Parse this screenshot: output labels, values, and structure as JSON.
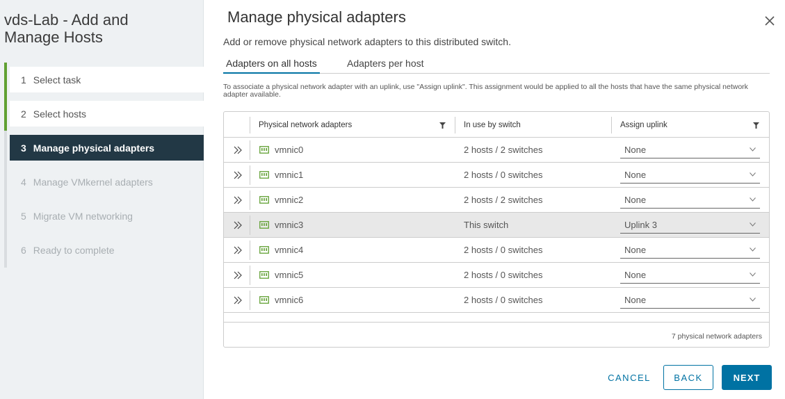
{
  "sidebar": {
    "title": "vds-Lab - Add and Manage Hosts",
    "steps": [
      {
        "num": "1",
        "label": "Select task"
      },
      {
        "num": "2",
        "label": "Select hosts"
      },
      {
        "num": "3",
        "label": "Manage physical adapters"
      },
      {
        "num": "4",
        "label": "Manage VMkernel adapters"
      },
      {
        "num": "5",
        "label": "Migrate VM networking"
      },
      {
        "num": "6",
        "label": "Ready to complete"
      }
    ]
  },
  "main": {
    "title": "Manage physical adapters",
    "subtitle": "Add or remove physical network adapters to this distributed switch.",
    "tabs": [
      {
        "label": "Adapters on all hosts"
      },
      {
        "label": "Adapters per host"
      }
    ],
    "note": "To associate a physical network adapter with an uplink, use \"Assign uplink\". This assignment would be applied to all the hosts that have the same physical network adapter available.",
    "grid": {
      "columns": [
        "Physical network adapters",
        "In use by switch",
        "Assign uplink"
      ],
      "rows": [
        {
          "name": "vmnic0",
          "in_use": "2 hosts / 2 switches",
          "uplink": "None"
        },
        {
          "name": "vmnic1",
          "in_use": "2 hosts / 0 switches",
          "uplink": "None"
        },
        {
          "name": "vmnic2",
          "in_use": "2 hosts / 2 switches",
          "uplink": "None"
        },
        {
          "name": "vmnic3",
          "in_use": "This switch",
          "uplink": "Uplink 3"
        },
        {
          "name": "vmnic4",
          "in_use": "2 hosts / 0 switches",
          "uplink": "None"
        },
        {
          "name": "vmnic5",
          "in_use": "2 hosts / 0 switches",
          "uplink": "None"
        },
        {
          "name": "vmnic6",
          "in_use": "2 hosts / 0 switches",
          "uplink": "None"
        }
      ],
      "footer": "7 physical network adapters"
    },
    "buttons": {
      "cancel": "CANCEL",
      "back": "BACK",
      "next": "NEXT"
    }
  },
  "colors": {
    "accent": "#0072a3",
    "active_step_bg": "#223845",
    "done_rail": "#60a032",
    "nic_icon": "#60a032"
  }
}
